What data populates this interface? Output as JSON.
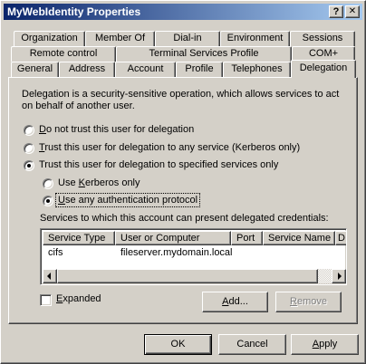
{
  "window": {
    "title": "MyWebIdentity Properties",
    "help_glyph": "?",
    "close_glyph": "✕"
  },
  "tabs": {
    "row1": [
      "Organization",
      "Member Of",
      "Dial-in",
      "Environment",
      "Sessions"
    ],
    "row2": [
      "Remote control",
      "Terminal Services Profile",
      "COM+"
    ],
    "row3": [
      "General",
      "Address",
      "Account",
      "Profile",
      "Telephones",
      "Delegation"
    ],
    "active": "Delegation"
  },
  "delegation": {
    "description": "Delegation is a security-sensitive operation, which allows services to act on behalf of another user.",
    "options": [
      {
        "key": "D",
        "rest": "o not trust this user for delegation",
        "checked": false
      },
      {
        "key": "T",
        "rest": "rust this user for delegation to any service (Kerberos only)",
        "checked": false
      },
      {
        "key": "",
        "rest": "Trust this user for delegation to specified services only",
        "checked": true
      }
    ],
    "sub_options": [
      {
        "pre": "Use ",
        "key": "K",
        "rest": "erberos only",
        "checked": false
      },
      {
        "pre": "",
        "key": "U",
        "rest": "se any authentication protocol",
        "checked": true
      }
    ],
    "services_label": "Services to which this account can present delegated credentials:",
    "columns": [
      "Service Type",
      "User or Computer",
      "Port",
      "Service Name",
      "D"
    ],
    "rows": [
      {
        "service_type": "cifs",
        "user_or_computer": "fileserver.mydomain.local",
        "port": "",
        "service_name": ""
      }
    ],
    "expanded": {
      "key": "E",
      "rest": "xpanded",
      "checked": false
    },
    "add_button": {
      "key": "A",
      "rest": "dd..."
    },
    "remove_button": {
      "key": "R",
      "rest": "emove"
    }
  },
  "footer": {
    "ok": "OK",
    "cancel": "Cancel",
    "apply": {
      "key": "A",
      "rest": "pply"
    }
  }
}
